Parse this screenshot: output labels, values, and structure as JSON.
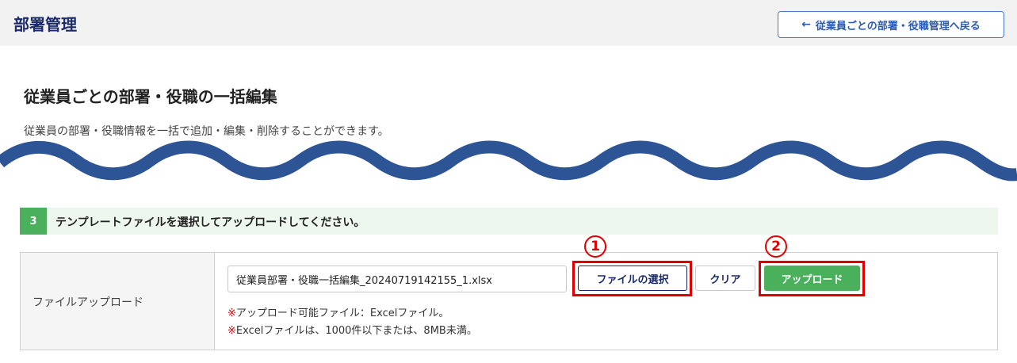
{
  "header": {
    "title": "部署管理",
    "back_button": {
      "arrow": "←",
      "label": "従業員ごとの部署・役職管理へ戻る",
      "icon": "arrow-left-icon"
    }
  },
  "page": {
    "title": "従業員ごとの部署・役職の一括編集",
    "description": "従業員の部署・役職情報を一括で追加・編集・削除することができます。"
  },
  "step": {
    "number": "3",
    "text": "テンプレートファイルを選択してアップロードしてください。"
  },
  "upload_form": {
    "label": "ファイルアップロード",
    "file_name": "従業員部署・役職一括編集_20240719142155_1.xlsx",
    "select_button": "ファイルの選択",
    "clear_button": "クリア",
    "upload_button": "アップロード",
    "note_mark": "※",
    "note1": "アップロード可能ファイル：Excelファイル。",
    "note2": "Excelファイルは、1000件以下または、8MB未満。"
  },
  "annotations": {
    "marker1": "1",
    "marker2": "2",
    "color": "#e00000"
  },
  "colors": {
    "accent_green": "#4ab05c",
    "navy": "#1a2a6c",
    "wave_blue": "#2d5596"
  }
}
